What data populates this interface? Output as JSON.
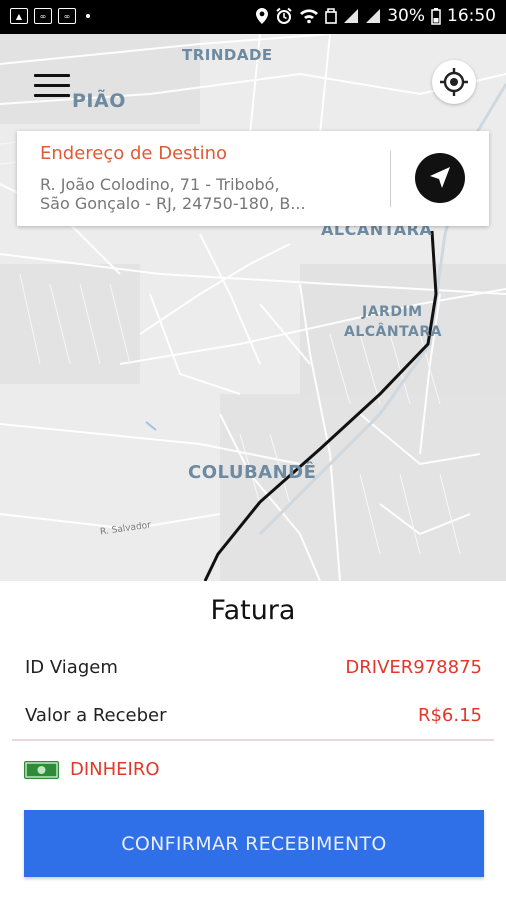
{
  "status_bar": {
    "battery": "30%",
    "time": "16:50"
  },
  "map": {
    "labels": {
      "trindade": "TRINDADE",
      "piao": "PIÃO",
      "alcantara": "ALCÂNTARA",
      "jardim_line1": "JARDIM",
      "jardim_line2": "ALCÂNTARA",
      "colubande": "COLUBANDÊ",
      "street": "R. Salvador"
    }
  },
  "destination": {
    "title": "Endereço de Destino",
    "address_line1": "R. João Colodino, 71 - Tribobó,",
    "address_line2": "São Gonçalo - RJ, 24750-180, B..."
  },
  "invoice": {
    "title": "Fatura",
    "trip_id_label": "ID Viagem",
    "trip_id_value": "DRIVER978875",
    "amount_label": "Valor a Receber",
    "amount_value": "R$6.15",
    "payment_method": "DINHEIRO",
    "confirm_button": "CONFIRMAR RECEBIMENTO"
  },
  "colors": {
    "accent_red": "#e0392b",
    "orange_title": "#e05a37",
    "button_blue": "#2f6fe7",
    "cash_green": "#2f8b3a"
  }
}
